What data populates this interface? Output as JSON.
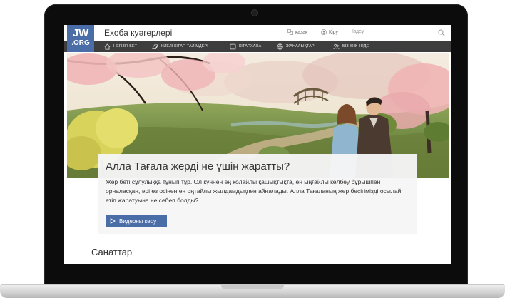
{
  "site": {
    "logo_line1": "JW",
    "logo_line2": ".ORG",
    "title": "Ехоба куәгерлері"
  },
  "topbar": {
    "language_label": "қазақ",
    "login_label": "Кіру",
    "search_placeholder": "Іздеу"
  },
  "nav": {
    "items": [
      {
        "label": "НЕГІЗГІ БЕТ",
        "icon": "home-icon"
      },
      {
        "label": "КИЕЛІ КІТАП ТАЛІМДЕРІ",
        "icon": "bible-icon"
      },
      {
        "label": "КІТАПХАНА",
        "icon": "library-icon"
      },
      {
        "label": "ЖАҢАЛЫҚТАР",
        "icon": "news-icon"
      },
      {
        "label": "БІЗ ЖӨНІНДЕ",
        "icon": "people-icon"
      }
    ]
  },
  "hero": {
    "headline": "Алла Тағала жерді не үшін жаратты?",
    "description": "Жер беті сұлулыққа тұнып тұр. Ол күннен ең қолайлы қашықтықта, ең ыңғайлы көлбеу бұрышпен орналасқан, әрі өз осінен ең оңтайлы жылдамдықпен айналады. Алла Тағаланың жер бесігімізді осылай етіп жаратуына не себеп болды?",
    "video_button": "Видеоны көру"
  },
  "categories_heading": "Санаттар",
  "colors": {
    "brand": "#4a6da7",
    "nav_background": "#3d3d3d"
  }
}
